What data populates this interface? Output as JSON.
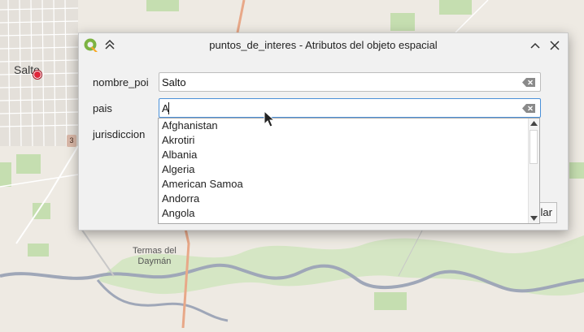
{
  "map": {
    "labels": {
      "city": "Salto",
      "place": "Termas del\nDaymán",
      "place_line1": "Termas del",
      "place_line2": "Daymán",
      "road_shield": "3"
    },
    "colors": {
      "land": "#eeeae3",
      "water": "#9fa7b8",
      "green": "#c5deb0",
      "urban": "#dcd8d2",
      "poi": "#e0263a"
    }
  },
  "dialog": {
    "title": "puntos_de_interes - Atributos del objeto espacial",
    "icons": [
      "qgis-logo-icon",
      "pin-collapse-icon",
      "chevron-up-icon",
      "close-icon"
    ],
    "fields": {
      "nombre_poi": {
        "label": "nombre_poi",
        "value": "Salto"
      },
      "pais": {
        "label": "pais",
        "value": "A"
      },
      "jurisdiccion": {
        "label": "jurisdiccion"
      }
    },
    "completer_items": [
      "Afghanistan",
      "Akrotiri",
      "Albania",
      "Algeria",
      "American Samoa",
      "Andorra",
      "Angola"
    ],
    "partial_button": "lar"
  }
}
